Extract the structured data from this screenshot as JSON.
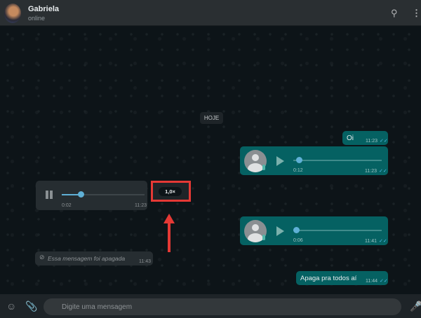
{
  "header": {
    "contact_name": "Gabriela",
    "status": "online",
    "icons": [
      "search-icon",
      "menu-icon"
    ]
  },
  "date_chip": "HOJE",
  "messages": [
    {
      "type": "text",
      "direction": "out",
      "text": "Oi",
      "time": "11:23"
    },
    {
      "type": "audio",
      "direction": "out",
      "duration": "0:12",
      "time": "11:23",
      "progress": 0.05
    },
    {
      "type": "audio",
      "direction": "in",
      "state": "playing",
      "elapsed": "0:02",
      "time": "11:23",
      "progress": 0.22,
      "speed": "1,0×"
    },
    {
      "type": "audio",
      "direction": "out",
      "duration": "0:06",
      "time": "11:41",
      "progress": 0.0
    },
    {
      "type": "deleted",
      "direction": "in",
      "text": "Essa mensagem foi apagada",
      "time": "11:43"
    },
    {
      "type": "text",
      "direction": "out",
      "text": "Apaga pra todos aí",
      "time": "11:44"
    }
  ],
  "annotation": {
    "color": "#e53935",
    "target": "speed-button"
  },
  "footer": {
    "placeholder": "Digite uma mensagem",
    "icons": [
      "emoji-icon",
      "attach-icon",
      "mic-icon"
    ]
  }
}
